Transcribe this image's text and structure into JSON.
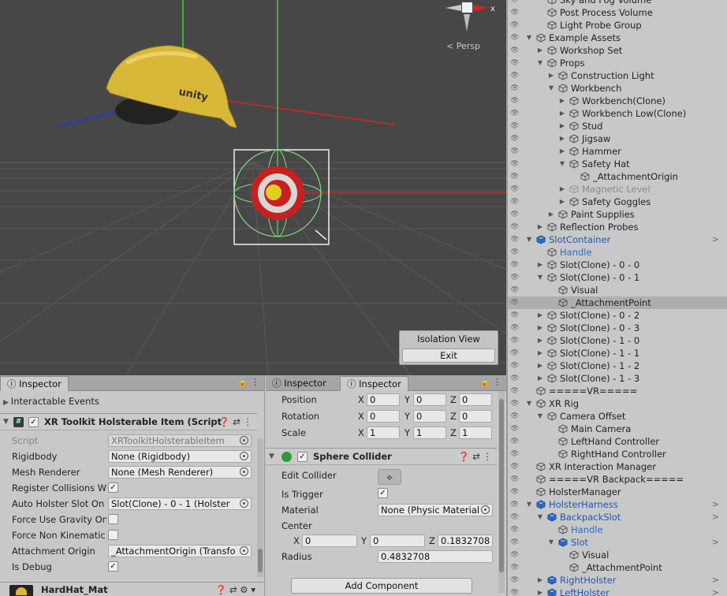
{
  "scene": {
    "persp_label": "< Persp",
    "gizmo_axis": "x",
    "isolation": {
      "title": "Isolation View",
      "exit_label": "Exit"
    },
    "helmet_logo": "unity"
  },
  "hierarchy": {
    "items": [
      {
        "label": "Sky and Fog Volume",
        "depth": 2,
        "arrow": "",
        "style": ""
      },
      {
        "label": "Post Process Volume",
        "depth": 2,
        "arrow": "",
        "style": ""
      },
      {
        "label": "Light Probe Group",
        "depth": 2,
        "arrow": "",
        "style": ""
      },
      {
        "label": "Example Assets",
        "depth": 1,
        "arrow": "down",
        "style": ""
      },
      {
        "label": "Workshop Set",
        "depth": 2,
        "arrow": "right",
        "style": ""
      },
      {
        "label": "Props",
        "depth": 2,
        "arrow": "down",
        "style": ""
      },
      {
        "label": "Construction Light",
        "depth": 3,
        "arrow": "right",
        "style": ""
      },
      {
        "label": "Workbench",
        "depth": 3,
        "arrow": "down",
        "style": ""
      },
      {
        "label": "Workbench(Clone)",
        "depth": 4,
        "arrow": "right",
        "style": ""
      },
      {
        "label": "Workbench Low(Clone)",
        "depth": 4,
        "arrow": "right",
        "style": ""
      },
      {
        "label": "Stud",
        "depth": 4,
        "arrow": "right",
        "style": ""
      },
      {
        "label": "Jigsaw",
        "depth": 4,
        "arrow": "right",
        "style": ""
      },
      {
        "label": "Hammer",
        "depth": 4,
        "arrow": "right",
        "style": ""
      },
      {
        "label": "Safety Hat",
        "depth": 4,
        "arrow": "down",
        "style": ""
      },
      {
        "label": "_AttachmentOrigin",
        "depth": 5,
        "arrow": "",
        "style": ""
      },
      {
        "label": "Magnetic Level",
        "depth": 4,
        "arrow": "right",
        "style": "dim"
      },
      {
        "label": "Safety Goggles",
        "depth": 4,
        "arrow": "right",
        "style": ""
      },
      {
        "label": "Paint Supplies",
        "depth": 3,
        "arrow": "right",
        "style": ""
      },
      {
        "label": "Reflection Probes",
        "depth": 2,
        "arrow": "right",
        "style": ""
      },
      {
        "label": "SlotContainer",
        "depth": 1,
        "arrow": "down",
        "style": "blue",
        "right": ">"
      },
      {
        "label": "Handle",
        "depth": 2,
        "arrow": "",
        "style": "cyan"
      },
      {
        "label": "Slot(Clone) - 0 - 0",
        "depth": 2,
        "arrow": "right",
        "style": ""
      },
      {
        "label": "Slot(Clone) - 0 - 1",
        "depth": 2,
        "arrow": "down",
        "style": ""
      },
      {
        "label": "Visual",
        "depth": 3,
        "arrow": "",
        "style": ""
      },
      {
        "label": "_AttachmentPoint",
        "depth": 3,
        "arrow": "",
        "style": "",
        "selected": true
      },
      {
        "label": "Slot(Clone) - 0 - 2",
        "depth": 2,
        "arrow": "right",
        "style": ""
      },
      {
        "label": "Slot(Clone) - 0 - 3",
        "depth": 2,
        "arrow": "right",
        "style": ""
      },
      {
        "label": "Slot(Clone) - 1 - 0",
        "depth": 2,
        "arrow": "right",
        "style": ""
      },
      {
        "label": "Slot(Clone) - 1 - 1",
        "depth": 2,
        "arrow": "right",
        "style": ""
      },
      {
        "label": "Slot(Clone) - 1 - 2",
        "depth": 2,
        "arrow": "right",
        "style": ""
      },
      {
        "label": "Slot(Clone) - 1 - 3",
        "depth": 2,
        "arrow": "right",
        "style": ""
      },
      {
        "label": "=====VR=====",
        "depth": 1,
        "arrow": "",
        "style": ""
      },
      {
        "label": "XR Rig",
        "depth": 1,
        "arrow": "down",
        "style": ""
      },
      {
        "label": "Camera Offset",
        "depth": 2,
        "arrow": "down",
        "style": ""
      },
      {
        "label": "Main Camera",
        "depth": 3,
        "arrow": "",
        "style": ""
      },
      {
        "label": "LeftHand Controller",
        "depth": 3,
        "arrow": "",
        "style": ""
      },
      {
        "label": "RightHand Controller",
        "depth": 3,
        "arrow": "",
        "style": ""
      },
      {
        "label": "XR Interaction Manager",
        "depth": 1,
        "arrow": "",
        "style": ""
      },
      {
        "label": "=====VR Backpack=====",
        "depth": 1,
        "arrow": "",
        "style": ""
      },
      {
        "label": "HolsterManager",
        "depth": 1,
        "arrow": "",
        "style": ""
      },
      {
        "label": "HolsterHarness",
        "depth": 1,
        "arrow": "down",
        "style": "blue",
        "right": ">"
      },
      {
        "label": "BackpackSlot",
        "depth": 2,
        "arrow": "down",
        "style": "blue",
        "right": ">"
      },
      {
        "label": "Handle",
        "depth": 3,
        "arrow": "",
        "style": "cyan"
      },
      {
        "label": "Slot",
        "depth": 3,
        "arrow": "down",
        "style": "blue",
        "right": ">"
      },
      {
        "label": "Visual",
        "depth": 4,
        "arrow": "",
        "style": ""
      },
      {
        "label": "_AttachmentPoint",
        "depth": 4,
        "arrow": "",
        "style": ""
      },
      {
        "label": "RightHolster",
        "depth": 2,
        "arrow": "right",
        "style": "blue",
        "right": ">"
      },
      {
        "label": "LeftHolster",
        "depth": 2,
        "arrow": "right",
        "style": "blue",
        "right": ">"
      }
    ]
  },
  "inspector_left": {
    "tab": "Inspector",
    "interactable_events": "Interactable Events",
    "component_title": "XR Toolkit Holsterable Item (Script",
    "props": [
      {
        "label": "Script",
        "value": "XRToolkitHolsterableItem",
        "kind": "ref",
        "readonly": true
      },
      {
        "label": "Rigidbody",
        "value": "None (Rigidbody)",
        "kind": "ref"
      },
      {
        "label": "Mesh Renderer",
        "value": "None (Mesh Renderer)",
        "kind": "ref"
      },
      {
        "label": "Register Collisions Wi",
        "value": "✓",
        "kind": "check"
      },
      {
        "label": "Auto Holster Slot On L",
        "value": "Slot(Clone) - 0 - 1 (Holster",
        "kind": "ref"
      },
      {
        "label": "Force Use Gravity On",
        "value": "",
        "kind": "check"
      },
      {
        "label": "Force Non Kinematic",
        "value": "",
        "kind": "check"
      },
      {
        "label": "Attachment Origin",
        "value": "_AttachmentOrigin (Transfo",
        "kind": "ref"
      },
      {
        "label": "Is Debug",
        "value": "✓",
        "kind": "check"
      }
    ],
    "material": "HardHat_Mat"
  },
  "inspector_right": {
    "tabs": [
      "Inspector",
      "Inspector"
    ],
    "transform": [
      {
        "label": "Position",
        "x": "0",
        "y": "0",
        "z": "0"
      },
      {
        "label": "Rotation",
        "x": "0",
        "y": "0",
        "z": "0"
      },
      {
        "label": "Scale",
        "x": "1",
        "y": "1",
        "z": "1"
      }
    ],
    "collider_title": "Sphere Collider",
    "edit_collider": "Edit Collider",
    "is_trigger_label": "Is Trigger",
    "is_trigger": "✓",
    "material_label": "Material",
    "material_value": "None (Physic Material",
    "center_label": "Center",
    "center": {
      "x": "0",
      "y": "0",
      "z": "0.1832708"
    },
    "radius_label": "Radius",
    "radius": "0.4832708",
    "add_component": "Add Component"
  }
}
